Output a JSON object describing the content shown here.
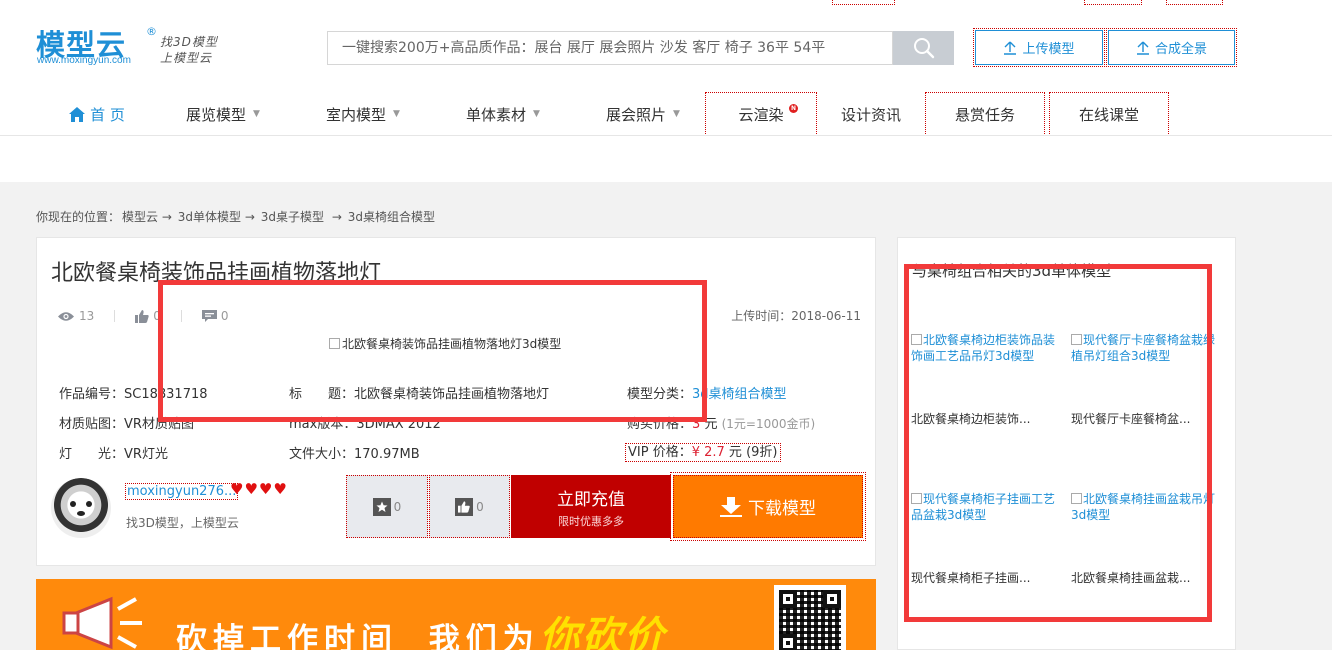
{
  "logo": {
    "text": "模型云",
    "reg": "®",
    "url": "www.moxingyun.com",
    "slogan_line1": "找3D模型",
    "slogan_line2": "上模型云"
  },
  "search": {
    "placeholder": "一键搜索200万+高品质作品：展台 展厅 展会照片 沙发 客厅 椅子 36平 54平"
  },
  "header_buttons": {
    "upload": "上传模型",
    "panorama": "合成全景"
  },
  "nav": {
    "home": "首 页",
    "exhibition": "展览模型",
    "interior": "室内模型",
    "single": "单体素材",
    "photos": "展会照片",
    "render": "云渲染",
    "render_badge": "N",
    "design": "设计资讯",
    "reward": "悬赏任务",
    "course": "在线课堂"
  },
  "breadcrumb": {
    "prefix": "你现在的位置：",
    "items": [
      "模型云",
      "→",
      "3d单体模型",
      "→",
      "3d桌子模型",
      "→",
      "3d桌椅组合模型"
    ]
  },
  "product": {
    "title": "北欧餐桌椅装饰品挂画植物落地灯",
    "views": "13",
    "likes": "0",
    "comments": "0",
    "upload_time_label": "上传时间：",
    "upload_time": "2018-06-11",
    "image_alt": "北欧餐桌椅装饰品挂画植物落地灯3d模型",
    "id_label": "作品编号：",
    "id_value": "SC18831718",
    "title_label": "标　　题：",
    "title_value": "北欧餐桌椅装饰品挂画植物落地灯",
    "category_label": "模型分类：",
    "category_value": "3d桌椅组合模型",
    "material_label": "材质贴图：",
    "material_value": "VR材质贴图",
    "max_label": "max版本：",
    "max_value": "3DMAX 2012",
    "price_label": "购买价格：",
    "price_value": "3",
    "price_unit": "元",
    "price_note": "(1元=1000金币)",
    "light_label": "灯　　光：",
    "light_value": "VR灯光",
    "size_label": "文件大小：",
    "size_value": "170.97MB",
    "vip_label": "VIP 价格：",
    "vip_value": "¥ 2.7",
    "vip_unit": "元",
    "vip_note": "(9折)"
  },
  "author": {
    "name": "moxingyun276...",
    "hearts": "♥♥♥♥",
    "desc": "找3D模型，上模型云"
  },
  "actions": {
    "fav_count": "0",
    "like_count": "0",
    "recharge_l1": "立即充值",
    "recharge_l2": "限时优惠多多",
    "download": "下载模型"
  },
  "banner": {
    "text1": "砍掉工作时间",
    "text2": "我们为",
    "highlight": "你砍价"
  },
  "side": {
    "title": "与桌椅组合相关的3d单体模型",
    "items": [
      {
        "alt": "北欧餐桌椅边柜装饰品装饰画工艺品吊灯3d模型",
        "name": "北欧餐桌椅边柜装饰..."
      },
      {
        "alt": "现代餐厅卡座餐椅盆栽绿植吊灯组合3d模型",
        "name": "现代餐厅卡座餐椅盆..."
      },
      {
        "alt": "现代餐桌椅柜子挂画工艺品盆栽3d模型",
        "name": "现代餐桌椅柜子挂画..."
      },
      {
        "alt": "北欧餐桌椅挂画盆栽吊灯3d模型",
        "name": "北欧餐桌椅挂画盆栽..."
      }
    ]
  },
  "colors": {
    "brand_blue": "#1f8fd6",
    "recharge_red": "#c00000",
    "download_orange": "#ff7a00",
    "annotation_red": "#f23a3a"
  }
}
